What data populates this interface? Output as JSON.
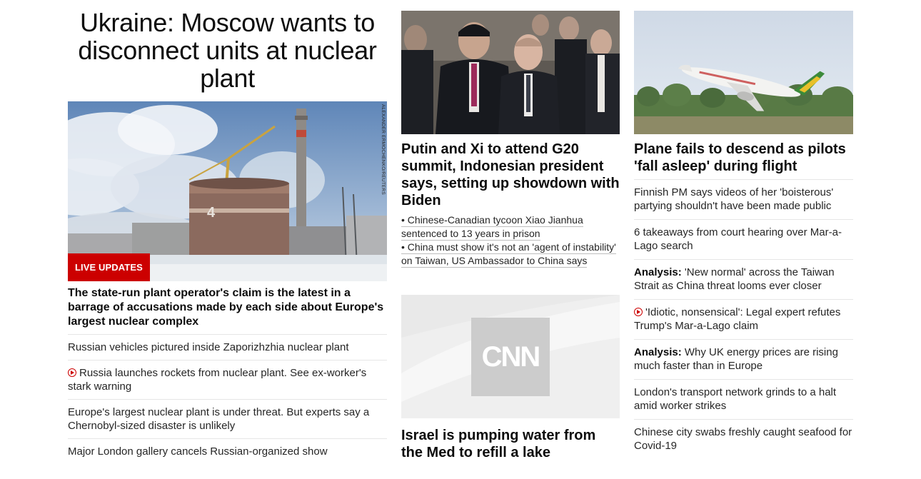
{
  "col1": {
    "headline": "Ukraine: Moscow wants to disconnect units at nuclear plant",
    "badge": "LIVE UPDATES",
    "photo_credit": "ALEXANDER ERMOCHENKO/REUTERS",
    "reactor_number": "4",
    "lead": "The state-run plant operator's claim is the latest in a barrage of accusations made by each side about Europe's largest nuclear complex",
    "links": [
      {
        "text": "Russian vehicles pictured inside Zaporizhzhia nuclear plant",
        "video": false
      },
      {
        "text": "Russia launches rockets from nuclear plant. See ex-worker's stark warning",
        "video": true
      },
      {
        "text": "Europe's largest nuclear plant is under threat. But experts say a Chernobyl-sized disaster is unlikely",
        "video": false
      },
      {
        "text": "Major London gallery cancels Russian-organized show",
        "video": false
      }
    ]
  },
  "col2": {
    "card1": {
      "title": "Putin and Xi to attend G20 summit, Indonesian president says, setting up showdown with Biden",
      "bullets": [
        "• Chinese-Canadian tycoon Xiao Jianhua sentenced to 13 years in prison",
        "• China must show it's not an 'agent of instability' on Taiwan, US Ambassador to China says"
      ]
    },
    "card2": {
      "logo": "CNN",
      "title": "Israel is pumping water from the Med to refill a lake"
    }
  },
  "col3": {
    "title": "Plane fails to descend as pilots 'fall asleep' during flight",
    "links": [
      {
        "prefix": "",
        "text": "Finnish PM says videos of her 'boisterous' partying shouldn't have been made public",
        "video": false
      },
      {
        "prefix": "",
        "text": "6 takeaways from court hearing over Mar-a-Lago search",
        "video": false
      },
      {
        "prefix": "Analysis:",
        "text": " 'New normal' across the Taiwan Strait as China threat looms ever closer",
        "video": false
      },
      {
        "prefix": "",
        "text": "'Idiotic, nonsensical': Legal expert refutes Trump's Mar-a-Lago claim",
        "video": true
      },
      {
        "prefix": "Analysis:",
        "text": " Why UK energy prices are rising much faster than in Europe",
        "video": false
      },
      {
        "prefix": "",
        "text": "London's transport network grinds to a halt amid worker strikes",
        "video": false
      },
      {
        "prefix": "",
        "text": "Chinese city swabs freshly caught seafood for Covid-19",
        "video": false
      }
    ]
  },
  "colors": {
    "accent_red": "#cc0000",
    "text": "#0c0c0c",
    "divider": "#e6e6e6"
  }
}
